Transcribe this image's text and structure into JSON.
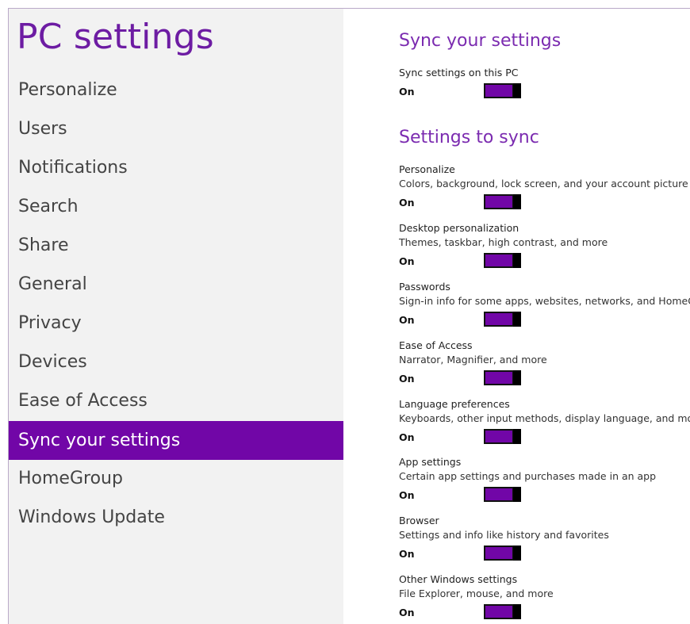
{
  "app_title": "PC settings",
  "accent_color": "#7106a7",
  "nav": {
    "selected": "Sync your settings",
    "items": [
      {
        "label": "Personalize"
      },
      {
        "label": "Users"
      },
      {
        "label": "Notifications"
      },
      {
        "label": "Search"
      },
      {
        "label": "Share"
      },
      {
        "label": "General"
      },
      {
        "label": "Privacy"
      },
      {
        "label": "Devices"
      },
      {
        "label": "Ease of Access"
      },
      {
        "label": "Sync your settings"
      },
      {
        "label": "HomeGroup"
      },
      {
        "label": "Windows Update"
      }
    ]
  },
  "main": {
    "heading": "Sync your settings",
    "sync_pc": {
      "label": "Sync settings on this PC",
      "state": "On",
      "on": true
    },
    "settings_heading": "Settings to sync",
    "settings": [
      {
        "name": "Personalize",
        "description": "Colors, background, lock screen, and your account picture",
        "state": "On",
        "on": true
      },
      {
        "name": "Desktop personalization",
        "description": "Themes, taskbar, high contrast, and more",
        "state": "On",
        "on": true
      },
      {
        "name": "Passwords",
        "description": "Sign-in info for some apps, websites, networks, and HomeGroup",
        "state": "On",
        "on": true
      },
      {
        "name": "Ease of Access",
        "description": "Narrator, Magnifier, and more",
        "state": "On",
        "on": true
      },
      {
        "name": "Language preferences",
        "description": "Keyboards, other input methods, display language, and more",
        "state": "On",
        "on": true
      },
      {
        "name": "App settings",
        "description": "Certain app settings and purchases made in an app",
        "state": "On",
        "on": true
      },
      {
        "name": "Browser",
        "description": "Settings and info like history and favorites",
        "state": "On",
        "on": true
      },
      {
        "name": "Other Windows settings",
        "description": "File Explorer, mouse, and more",
        "state": "On",
        "on": true
      }
    ]
  }
}
